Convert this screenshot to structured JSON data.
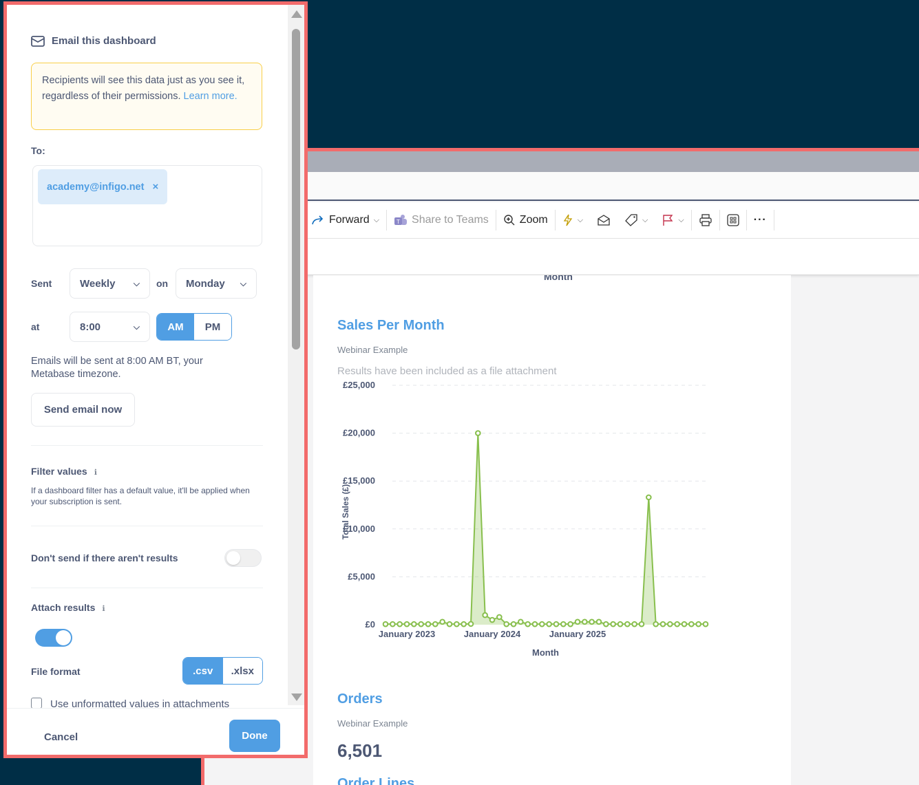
{
  "panel": {
    "title": "Email this dashboard",
    "notice": {
      "text": "Recipients will see this data just as you see it, regardless of their permissions.",
      "link": "Learn more."
    },
    "to_label": "To:",
    "recipient": "academy@infigo.net",
    "sent_label": "Sent",
    "frequency": "Weekly",
    "on_label": "on",
    "day": "Monday",
    "at_label": "at",
    "time": "8:00",
    "am": "AM",
    "pm": "PM",
    "timezone_note": "Emails will be sent at 8:00 AM BT, your Metabase timezone.",
    "send_now": "Send email now",
    "filter_title": "Filter values",
    "filter_note": "If a dashboard filter has a default value, it'll be applied when your subscription is sent.",
    "dont_send": "Don't send if there aren't results",
    "dont_send_on": false,
    "attach_title": "Attach results",
    "attach_on": true,
    "file_format_label": "File format",
    "csv": ".csv",
    "xlsx": ".xlsx",
    "unformatted": "Use unformatted values in attachments",
    "cancel": "Cancel",
    "done": "Done"
  },
  "toolbar": {
    "forward": "Forward",
    "share": "Share to Teams",
    "zoom": "Zoom"
  },
  "body": {
    "cut_label": "Month",
    "card1": {
      "title": "Sales Per Month",
      "subtitle": "Webinar Example",
      "note": "Results have been included as a file attachment"
    },
    "card2": {
      "title": "Orders",
      "subtitle": "Webinar Example",
      "value": "6,501"
    },
    "card3_title": "Order Lines"
  },
  "chart_data": {
    "type": "area",
    "xlabel": "Month",
    "ylabel": "Total Sales (£)",
    "ylim": [
      0,
      25000
    ],
    "yticks": [
      "£0",
      "£5,000",
      "£10,000",
      "£15,000",
      "£20,000",
      "£25,000"
    ],
    "xticks": [
      "January 2023",
      "January 2024",
      "January 2025"
    ],
    "series_color": "#88bf4d",
    "values": [
      60,
      60,
      60,
      60,
      60,
      60,
      60,
      60,
      300,
      60,
      60,
      60,
      80,
      20000,
      1000,
      500,
      800,
      60,
      60,
      300,
      60,
      60,
      60,
      60,
      60,
      60,
      60,
      300,
      300,
      300,
      300,
      60,
      60,
      60,
      60,
      60,
      60,
      13300,
      60,
      60,
      60,
      60,
      60,
      60,
      60,
      60
    ]
  }
}
